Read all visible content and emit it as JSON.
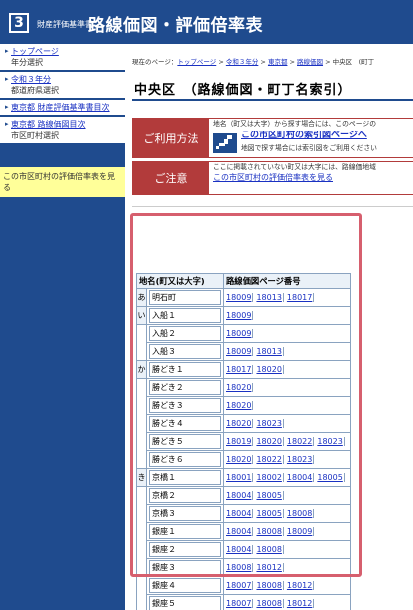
{
  "header": {
    "logo_number": "3",
    "logo_sub": "財産評価基準書",
    "title": "路線価図・評価倍率表"
  },
  "sidebar": {
    "items": [
      {
        "link": "トップページ",
        "sub": "年分選択"
      },
      {
        "link": "令和３年分",
        "sub": "都道府県選択"
      },
      {
        "link": "東京都 財産評価基準書目次",
        "sub": ""
      },
      {
        "link": "東京都 路線価図目次",
        "sub": "市区町村選択"
      }
    ],
    "notice": "この市区町村の評価倍率表を見る"
  },
  "main": {
    "breadcrumb": {
      "prefix": "現在のページ：",
      "links": [
        "トップページ",
        "令和３年分",
        "東京都",
        "路線価図"
      ],
      "sep": " > ",
      "tail": " > 中央区　(町丁"
    },
    "title": "中央区　（路線価図・町丁名索引）",
    "usage": {
      "label": "ご利用方法",
      "line1": "地名（町又は大字）から探す場合には、このページの",
      "link": "この市区町村の索引図ページへ",
      "line2": "地図で探す場合には索引図をご利用ください"
    },
    "caution": {
      "label": "ご注意",
      "line1": "ここに掲載されていない町又は大字には、路線価地域",
      "link": "この市区町村の評価倍率表を見る"
    }
  },
  "table": {
    "headers": [
      "地名(町又は大字)",
      "路線価図ページ番号"
    ],
    "rows": [
      {
        "kana": "あ",
        "area": "明石町",
        "pages": [
          "18009",
          "18013",
          "18017"
        ]
      },
      {
        "kana": "い",
        "area": "入船１",
        "pages": [
          "18009"
        ]
      },
      {
        "kana": "",
        "area": "入船２",
        "pages": [
          "18009"
        ]
      },
      {
        "kana": "",
        "area": "入船３",
        "pages": [
          "18009",
          "18013"
        ]
      },
      {
        "kana": "か",
        "area": "勝どき１",
        "pages": [
          "18017",
          "18020"
        ]
      },
      {
        "kana": "",
        "area": "勝どき２",
        "pages": [
          "18020"
        ]
      },
      {
        "kana": "",
        "area": "勝どき３",
        "pages": [
          "18020"
        ]
      },
      {
        "kana": "",
        "area": "勝どき４",
        "pages": [
          "18020",
          "18023"
        ]
      },
      {
        "kana": "",
        "area": "勝どき５",
        "pages": [
          "18019",
          "18020",
          "18022",
          "18023"
        ]
      },
      {
        "kana": "",
        "area": "勝どき６",
        "pages": [
          "18020",
          "18022",
          "18023"
        ]
      },
      {
        "kana": "き",
        "area": "京橋１",
        "pages": [
          "18001",
          "18002",
          "18004",
          "18005"
        ]
      },
      {
        "kana": "",
        "area": "京橋２",
        "pages": [
          "18004",
          "18005"
        ]
      },
      {
        "kana": "",
        "area": "京橋３",
        "pages": [
          "18004",
          "18005",
          "18008"
        ]
      },
      {
        "kana": "",
        "area": "銀座１",
        "pages": [
          "18004",
          "18008",
          "18009"
        ]
      },
      {
        "kana": "",
        "area": "銀座２",
        "pages": [
          "18004",
          "18008"
        ]
      },
      {
        "kana": "",
        "area": "銀座３",
        "pages": [
          "18008",
          "18012"
        ]
      },
      {
        "kana": "",
        "area": "銀座４",
        "pages": [
          "18007",
          "18008",
          "18012"
        ]
      },
      {
        "kana": "",
        "area": "銀座５",
        "pages": [
          "18007",
          "18008",
          "18012"
        ]
      }
    ]
  },
  "colors": {
    "brand_blue": "#1f4b8e",
    "accent_red": "#b23b3b",
    "highlight_frame": "#d65f6e",
    "link": "#1a31c2",
    "notice_bg": "#ffff99"
  }
}
